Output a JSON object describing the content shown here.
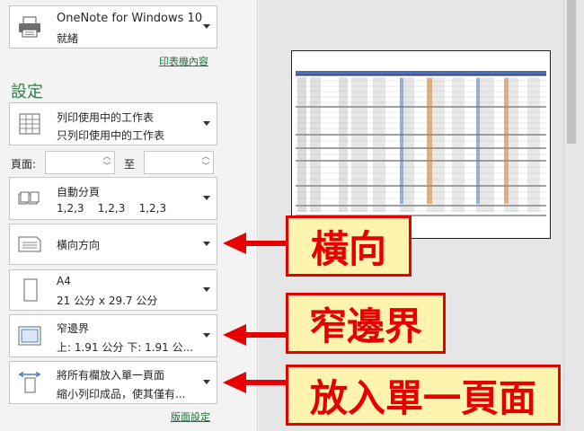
{
  "printer": {
    "name": "OneNote for Windows 10",
    "status": "就緒",
    "icon": "printer-icon"
  },
  "printer_properties_link": "印表機內容",
  "settings_title": "設定",
  "print_what": {
    "line1": "列印使用中的工作表",
    "line2": "只列印使用中的工作表",
    "icon": "sheet-grid-icon"
  },
  "pages": {
    "from_label": "頁面:",
    "to_label": "至",
    "from_value": "",
    "to_value": ""
  },
  "collation": {
    "line1": "自動分頁",
    "line2": "1,2,3    1,2,3    1,2,3",
    "icon": "collate-icon"
  },
  "orientation": {
    "line1": "橫向方向",
    "icon": "landscape-page-icon"
  },
  "paper_size": {
    "line1": "A4",
    "line2": "21 公分 x 29.7 公分",
    "icon": "portrait-page-icon"
  },
  "margins": {
    "line1": "窄邊界",
    "line2": "上: 1.91 公分 下: 1.91 公...",
    "icon": "margins-icon"
  },
  "scaling": {
    "line1": "將所有欄放入單一頁面",
    "line2": "縮小列印成品，使其僅有...",
    "icon": "fit-columns-icon"
  },
  "page_setup_link": "版面設定",
  "callouts": {
    "orientation": "橫向",
    "margins": "窄邊界",
    "scaling": "放入單一頁面"
  },
  "colors": {
    "accent_green": "#2e7d4a",
    "callout_red": "#e60000",
    "callout_fill": "#fff3b0"
  }
}
